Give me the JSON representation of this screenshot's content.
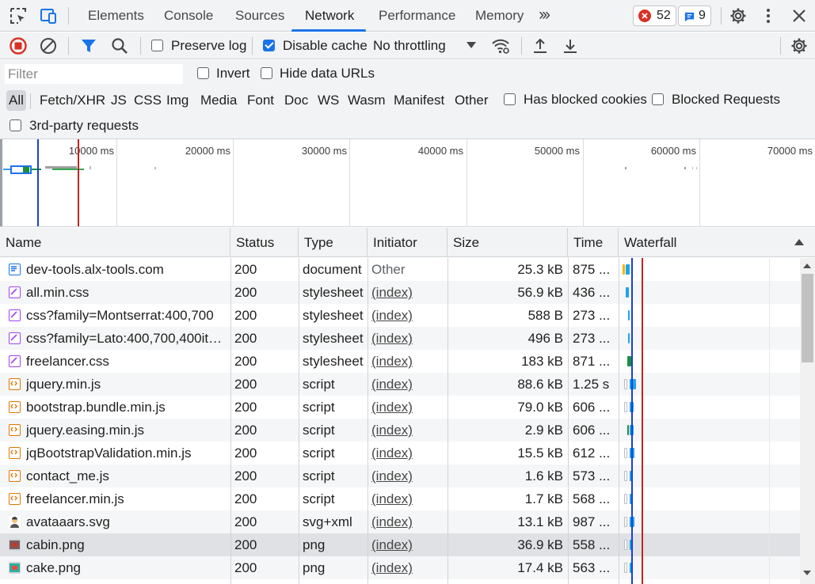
{
  "tabs": [
    {
      "label": "Elements",
      "active": false
    },
    {
      "label": "Console",
      "active": false
    },
    {
      "label": "Sources",
      "active": false
    },
    {
      "label": "Network",
      "active": true
    },
    {
      "label": "Performance",
      "active": false
    },
    {
      "label": "Memory",
      "active": false
    }
  ],
  "badges": {
    "errors": "52",
    "messages": "9"
  },
  "toolbar": {
    "preserve_log": "Preserve log",
    "disable_cache": "Disable cache",
    "throttling": "No throttling"
  },
  "filter": {
    "placeholder": "Filter",
    "invert": "Invert",
    "hide_data_urls": "Hide data URLs",
    "types": [
      "All",
      "Fetch/XHR",
      "JS",
      "CSS",
      "Img",
      "Media",
      "Font",
      "Doc",
      "WS",
      "Wasm",
      "Manifest",
      "Other"
    ],
    "has_blocked_cookies": "Has blocked cookies",
    "blocked_requests": "Blocked Requests",
    "third_party": "3rd-party requests"
  },
  "overview": {
    "ticks": [
      "10000 ms",
      "20000 ms",
      "30000 ms",
      "40000 ms",
      "50000 ms",
      "60000 ms",
      "70000 ms"
    ]
  },
  "columns": {
    "name": "Name",
    "status": "Status",
    "type": "Type",
    "initiator": "Initiator",
    "size": "Size",
    "time": "Time",
    "waterfall": "Waterfall"
  },
  "rows": [
    {
      "name": "dev-tools.alx-tools.com",
      "status": "200",
      "type": "document",
      "initiator": "Other",
      "size": "25.3 kB",
      "time": "875 ...",
      "icon": "document-icon"
    },
    {
      "name": "all.min.css",
      "status": "200",
      "type": "stylesheet",
      "initiator": "(index)",
      "size": "56.9 kB",
      "time": "436 ...",
      "icon": "stylesheet-icon"
    },
    {
      "name": "css?family=Montserrat:400,700",
      "status": "200",
      "type": "stylesheet",
      "initiator": "(index)",
      "size": "588 B",
      "time": "273 ...",
      "icon": "stylesheet-icon"
    },
    {
      "name": "css?family=Lato:400,700,400itali...",
      "status": "200",
      "type": "stylesheet",
      "initiator": "(index)",
      "size": "496 B",
      "time": "273 ...",
      "icon": "stylesheet-icon"
    },
    {
      "name": "freelancer.css",
      "status": "200",
      "type": "stylesheet",
      "initiator": "(index)",
      "size": "183 kB",
      "time": "871 ...",
      "icon": "stylesheet-icon"
    },
    {
      "name": "jquery.min.js",
      "status": "200",
      "type": "script",
      "initiator": "(index)",
      "size": "88.6 kB",
      "time": "1.25 s",
      "icon": "script-icon"
    },
    {
      "name": "bootstrap.bundle.min.js",
      "status": "200",
      "type": "script",
      "initiator": "(index)",
      "size": "79.0 kB",
      "time": "606 ...",
      "icon": "script-icon"
    },
    {
      "name": "jquery.easing.min.js",
      "status": "200",
      "type": "script",
      "initiator": "(index)",
      "size": "2.9 kB",
      "time": "606 ...",
      "icon": "script-icon"
    },
    {
      "name": "jqBootstrapValidation.min.js",
      "status": "200",
      "type": "script",
      "initiator": "(index)",
      "size": "15.5 kB",
      "time": "612 ...",
      "icon": "script-icon"
    },
    {
      "name": "contact_me.js",
      "status": "200",
      "type": "script",
      "initiator": "(index)",
      "size": "1.6 kB",
      "time": "573 ...",
      "icon": "script-icon"
    },
    {
      "name": "freelancer.min.js",
      "status": "200",
      "type": "script",
      "initiator": "(index)",
      "size": "1.7 kB",
      "time": "568 ...",
      "icon": "script-icon"
    },
    {
      "name": "avataaars.svg",
      "status": "200",
      "type": "svg+xml",
      "initiator": "(index)",
      "size": "13.1 kB",
      "time": "987 ...",
      "icon": "avatar-image-icon"
    },
    {
      "name": "cabin.png",
      "status": "200",
      "type": "png",
      "initiator": "(index)",
      "size": "36.9 kB",
      "time": "558 ...",
      "icon": "image-icon"
    },
    {
      "name": "cake.png",
      "status": "200",
      "type": "png",
      "initiator": "(index)",
      "size": "17.4 kB",
      "time": "563 ...",
      "icon": "image-icon"
    }
  ],
  "colors": {
    "accent": "#1a73e8",
    "record": "#d93025",
    "dom_loaded_line": "#1a3fd8",
    "load_line": "#c5221f",
    "waterfall_bar": "#0ea5e9"
  }
}
